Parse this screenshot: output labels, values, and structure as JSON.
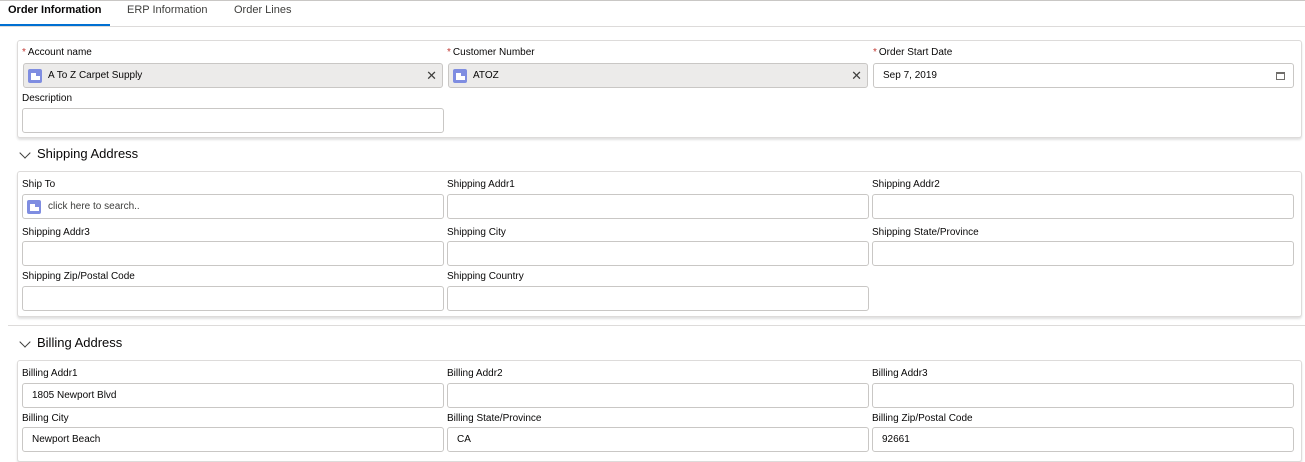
{
  "tabs": [
    "Order Information",
    "ERP Information",
    "Order Lines"
  ],
  "order": {
    "account_label": "Account name",
    "account_value": "A To Z Carpet Supply",
    "customer_label": "Customer Number",
    "customer_value": "ATOZ",
    "start_label": "Order Start Date",
    "start_value": "Sep 7, 2019",
    "description_label": "Description",
    "description_value": ""
  },
  "shipping": {
    "title": "Shipping Address",
    "ship_to_label": "Ship To",
    "ship_to_placeholder": "click here to search..",
    "addr1_label": "Shipping Addr1",
    "addr2_label": "Shipping Addr2",
    "addr3_label": "Shipping Addr3",
    "city_label": "Shipping City",
    "state_label": "Shipping State/Province",
    "zip_label": "Shipping Zip/Postal Code",
    "country_label": "Shipping Country"
  },
  "billing": {
    "title": "Billing Address",
    "addr1_label": "Billing Addr1",
    "addr1_value": "1805 Newport Blvd",
    "addr2_label": "Billing Addr2",
    "addr2_value": "",
    "addr3_label": "Billing Addr3",
    "addr3_value": "",
    "city_label": "Billing City",
    "city_value": "Newport Beach",
    "state_label": "Billing State/Province",
    "state_value": "CA",
    "zip_label": "Billing Zip/Postal Code",
    "zip_value": "92661"
  },
  "icons": {
    "lookup": "account-object-icon",
    "clear": "close-icon",
    "date": "calendar-icon",
    "section": "chevron-down-icon"
  },
  "colors": {
    "accent": "#0070d2",
    "required": "#c23934",
    "object_icon": "#7f8de1",
    "pill_bg": "#ecebea"
  }
}
